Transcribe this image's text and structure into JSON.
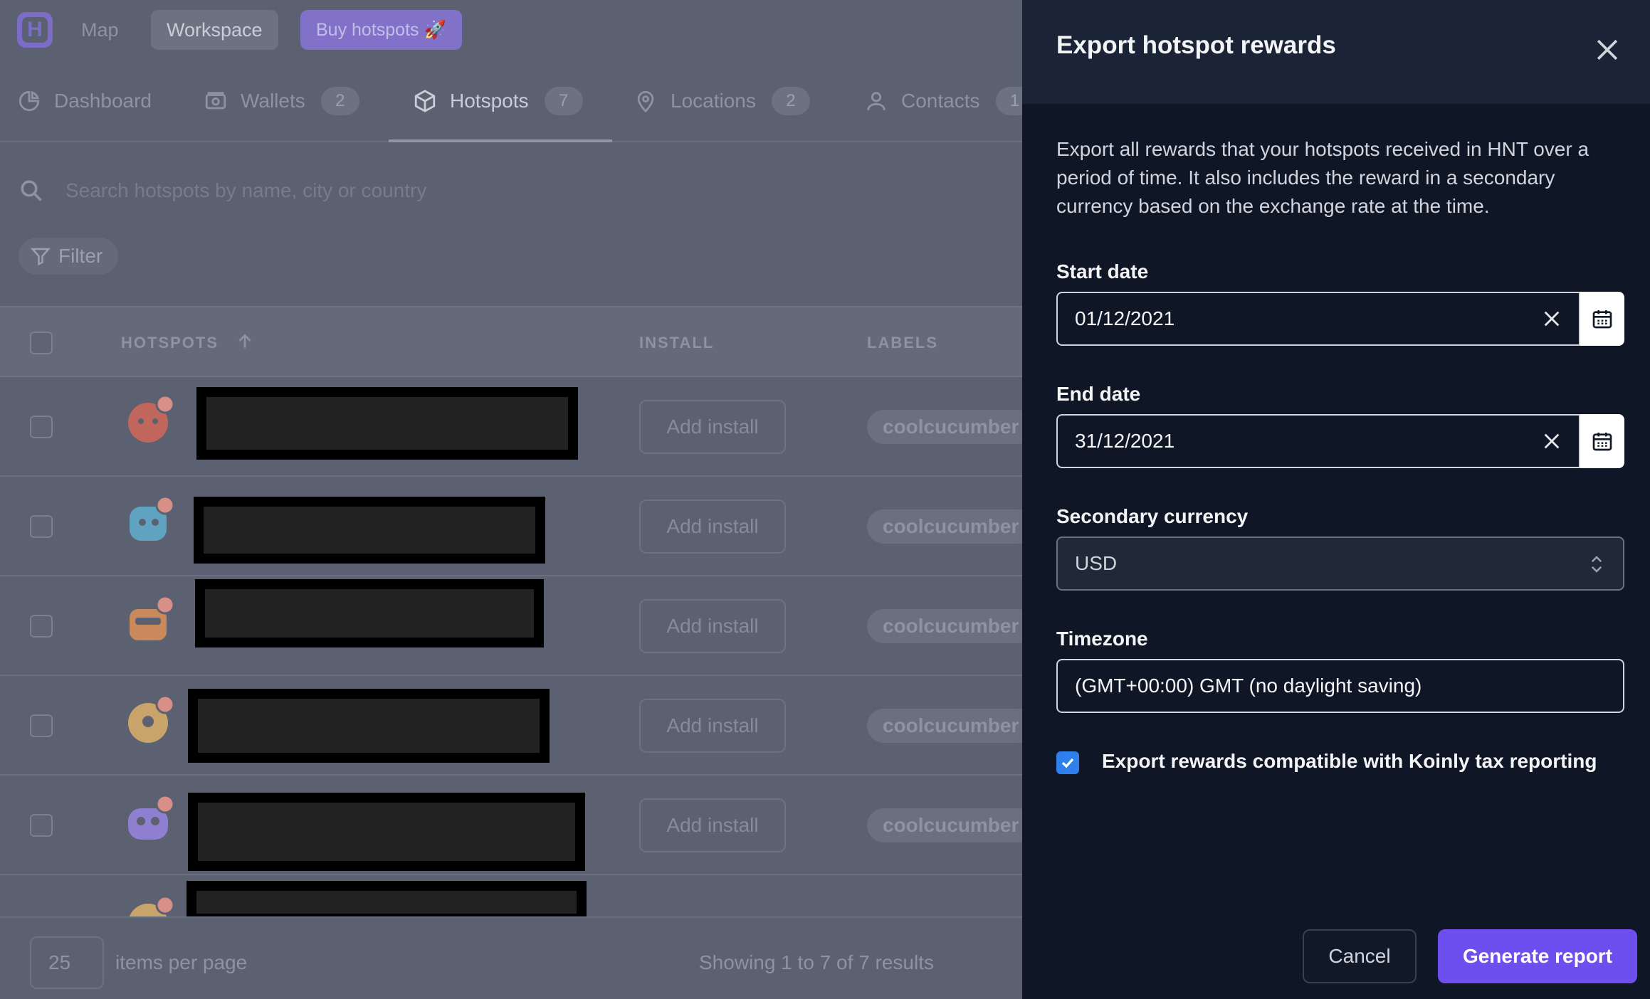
{
  "nav": {
    "logo_letter": "H",
    "map_label": "Map",
    "workspace_label": "Workspace",
    "buy_label": "Buy hotspots 🚀"
  },
  "tabs": [
    {
      "label": "Dashboard",
      "icon": "pie-chart-icon"
    },
    {
      "label": "Wallets",
      "count": "2",
      "icon": "wallet-icon"
    },
    {
      "label": "Hotspots",
      "count": "7",
      "icon": "cube-icon",
      "active": true
    },
    {
      "label": "Locations",
      "count": "2",
      "icon": "map-pin-icon"
    },
    {
      "label": "Contacts",
      "count": "1",
      "icon": "user-icon"
    }
  ],
  "search": {
    "placeholder": "Search hotspots by name, city or country"
  },
  "filter_label": "Filter",
  "table": {
    "headers": {
      "hotspots": "HOTSPOTS",
      "install": "INSTALL",
      "labels": "LABELS"
    },
    "rows": [
      {
        "install": "Add install",
        "label": "coolcucumber",
        "avatar_color": "#c0665c"
      },
      {
        "install": "Add install",
        "label": "coolcucumber",
        "avatar_color": "#5fa3c0"
      },
      {
        "install": "Add install",
        "label": "coolcucumber",
        "avatar_color": "#c9895a"
      },
      {
        "install": "Add install",
        "label": "coolcucumber",
        "avatar_color": "#c9a46a"
      },
      {
        "install": "Add install",
        "label": "coolcucumber",
        "avatar_color": "#8f7fd0"
      }
    ]
  },
  "footer": {
    "per_page_value": "25",
    "per_page_label": "items per page",
    "showing": "Showing 1 to 7 of 7 results"
  },
  "panel": {
    "title": "Export hotspot rewards",
    "description": "Export all rewards that your hotspots received in HNT over a period of time. It also includes the reward in a secondary currency based on the exchange rate at the time.",
    "start_date_label": "Start date",
    "start_date_value": "01/12/2021",
    "end_date_label": "End date",
    "end_date_value": "31/12/2021",
    "currency_label": "Secondary currency",
    "currency_value": "USD",
    "timezone_label": "Timezone",
    "timezone_value": "(GMT+00:00) GMT (no daylight saving)",
    "koinly_label": "Export rewards compatible with Koinly tax reporting",
    "koinly_checked": true,
    "cancel_label": "Cancel",
    "generate_label": "Generate report"
  },
  "colors": {
    "accent": "#6d4ff0",
    "panel_bg": "#0f1727",
    "checkbox": "#2f80ed"
  }
}
